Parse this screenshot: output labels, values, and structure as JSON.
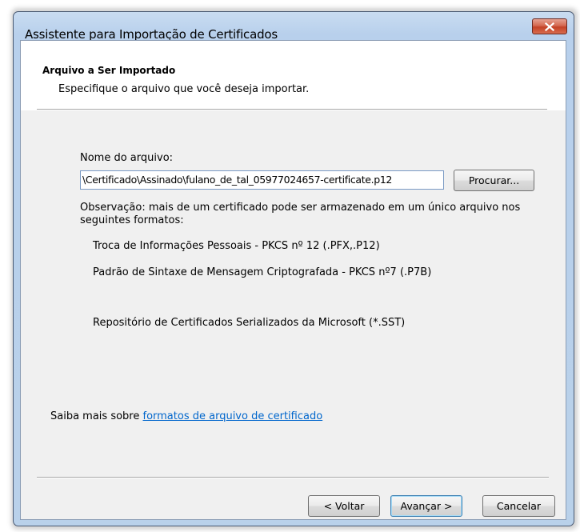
{
  "window": {
    "title": "Assistente para Importação de Certificados"
  },
  "header": {
    "title": "Arquivo a Ser Importado",
    "subtitle": "Especifique o arquivo que você deseja importar."
  },
  "file": {
    "label": "Nome do arquivo:",
    "value": "\\Certificado\\Assinado\\fulano_de_tal_05977024657-certificate.p12",
    "browse_label": "Procurar..."
  },
  "note": {
    "line1": "Observação: mais de um certificado pode ser armazenado em um único arquivo nos",
    "line2": "seguintes formatos:"
  },
  "formats": [
    "Troca de Informações Pessoais - PKCS nº 12 (.PFX,.P12)",
    "Padrão de Sintaxe de Mensagem Criptografada - PKCS nº7 (.P7B)",
    "Repositório de Certificados Serializados da Microsoft (*.SST)"
  ],
  "learn_more": {
    "prefix": "Saiba mais sobre ",
    "link": "formatos de arquivo de certificado"
  },
  "buttons": {
    "back": "< Voltar",
    "next": "Avançar >",
    "cancel": "Cancelar"
  }
}
